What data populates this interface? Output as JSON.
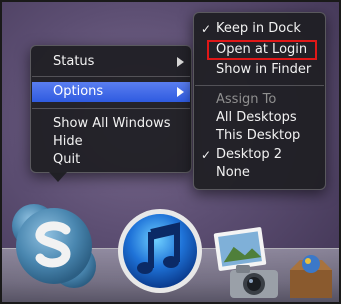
{
  "main_menu": {
    "items": [
      {
        "label": "Status",
        "has_submenu": true
      },
      {
        "label": "Options",
        "has_submenu": true,
        "highlighted": true
      },
      {
        "label": "Show All Windows"
      },
      {
        "label": "Hide"
      },
      {
        "label": "Quit"
      }
    ]
  },
  "options_submenu": {
    "keep_in_dock": "Keep in Dock",
    "open_at_login": "Open at Login",
    "show_in_finder": "Show in Finder",
    "assign_to_header": "Assign To",
    "all_desktops": "All Desktops",
    "this_desktop": "This Desktop",
    "desktop_2": "Desktop 2",
    "none": "None",
    "check_glyph": "✓"
  },
  "colors": {
    "highlight": "#2f5be0",
    "annotation_box": "#e01818",
    "menu_background": "#1e1e22"
  },
  "dock": {
    "icons": [
      "skype-icon",
      "itunes-icon",
      "photos-icon",
      "camera-icon",
      "box-icon"
    ]
  }
}
